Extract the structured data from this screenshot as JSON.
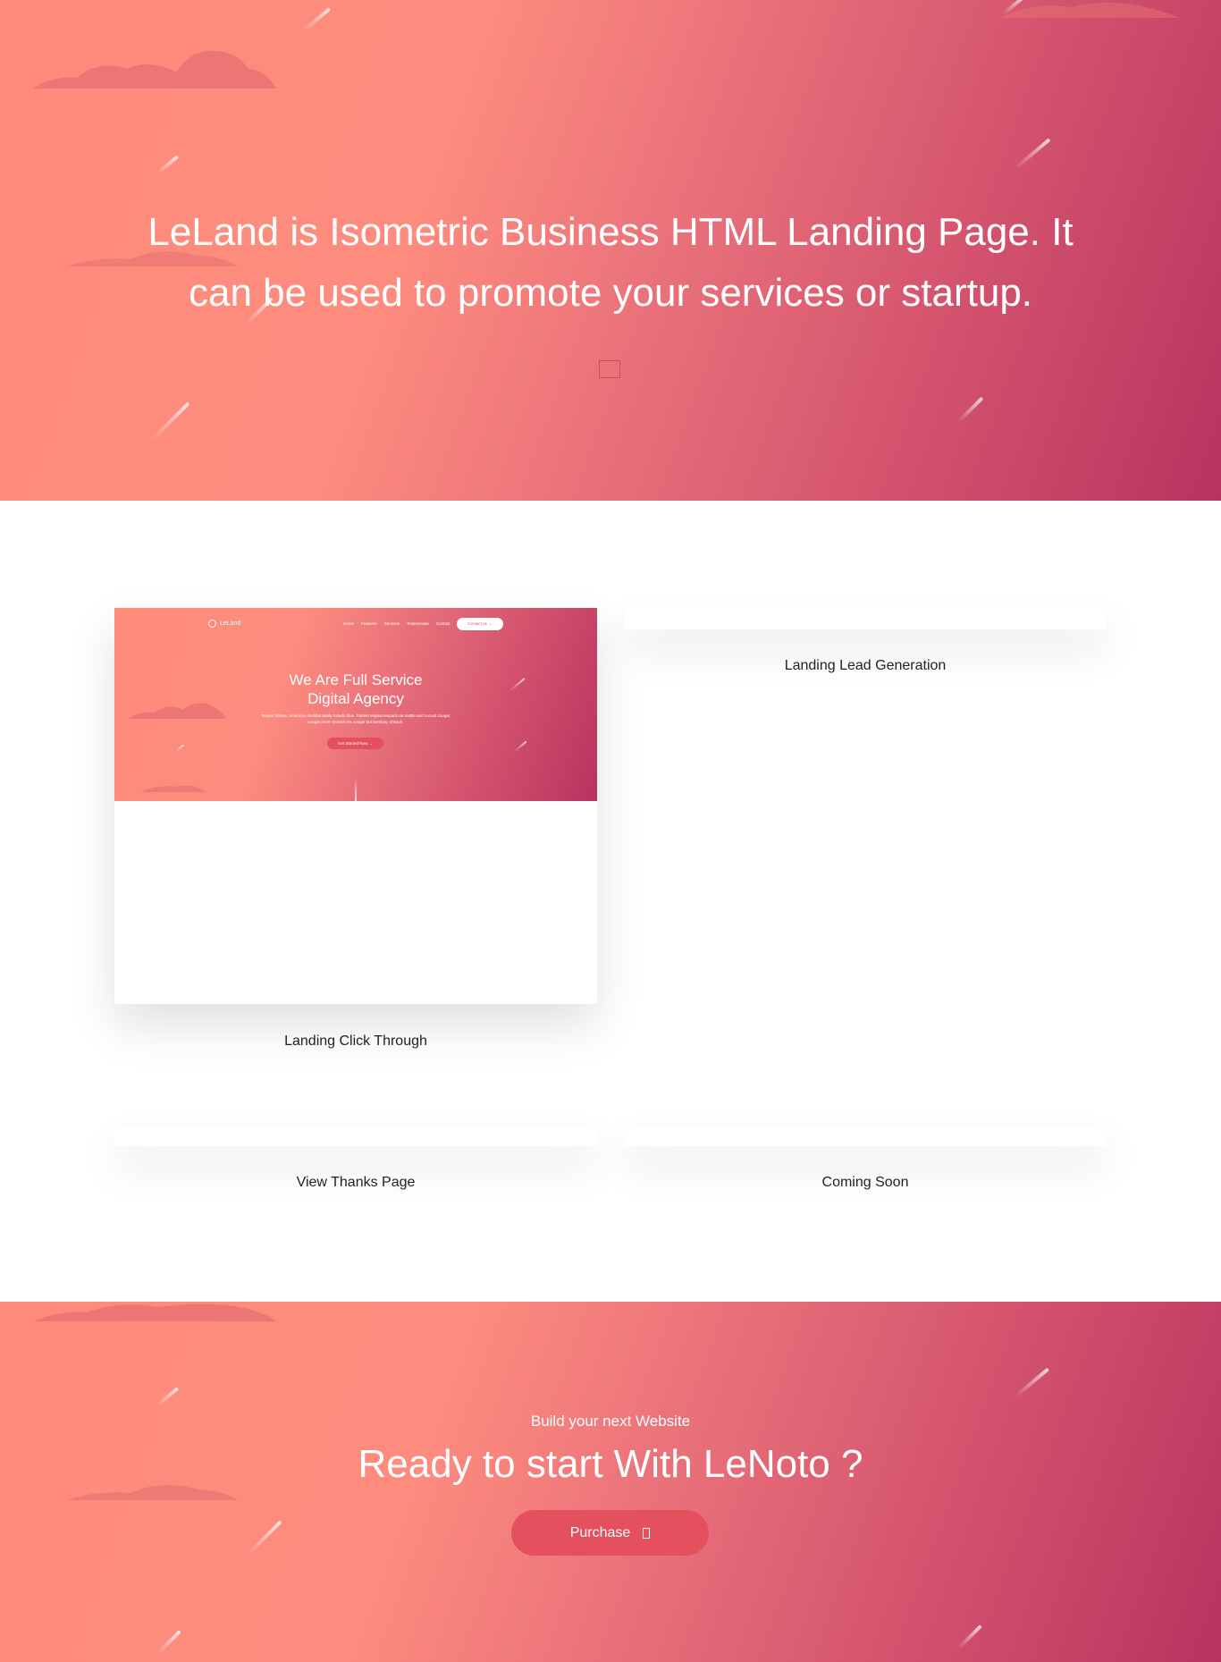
{
  "hero": {
    "title_line1": "LeLand is Isometric Business HTML Landing Page. It",
    "title_line2": "can be used to promote your services or startup."
  },
  "demos": {
    "click_through": {
      "label": "Landing Click Through",
      "preview": {
        "logo": "LeLand",
        "nav": [
          "Home",
          "Features",
          "Services",
          "Testimonials",
          "Contact"
        ],
        "contact_button": "Contact us →",
        "heading_line1": "We Are Full Service",
        "heading_line2": "Digital Agency",
        "paragraph": "Tempor littleas. American eterlibal teddy rosada blue. Parkett engma leopard cat mattle and cocoat cougar, cougar more. Donish rex cougar but bombay, ohsaoh.",
        "cta": "Get Started Now →"
      }
    },
    "lead_generation": {
      "label": "Landing Lead Generation"
    },
    "thanks": {
      "label": "View Thanks Page"
    },
    "coming_soon": {
      "label": "Coming Soon"
    }
  },
  "cta": {
    "subtitle": "Build your next Website",
    "title": "Ready to start With LeNoto ?",
    "button_label": "Purchase",
    "button_icon": "cart-icon"
  },
  "colors": {
    "gradient_start": "#ff8b7b",
    "gradient_end": "#b83360",
    "button": "#e5505f",
    "cloud": "#e87373"
  }
}
